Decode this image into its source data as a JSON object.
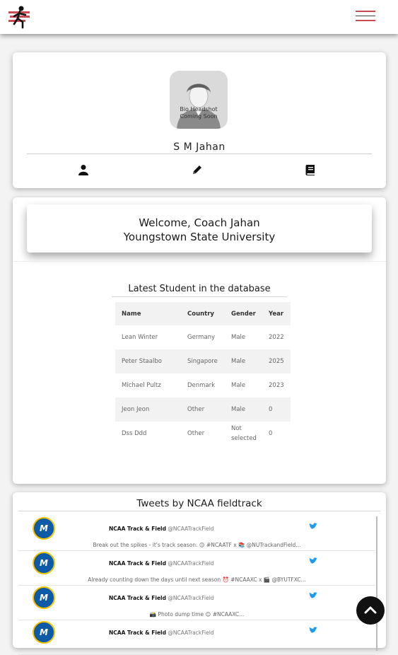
{
  "header": {
    "logo_icon": "runner-logo-icon",
    "menu_icon": "hamburger-menu-icon",
    "accent_color": "#c94c55"
  },
  "profile": {
    "avatar_caption_line1": "Bio Headshot",
    "avatar_caption_line2": "Coming Soon",
    "name": "S M Jahan",
    "icons": [
      "user-icon",
      "pencil-icon",
      "book-icon"
    ]
  },
  "welcome": {
    "line1": "Welcome, Coach Jahan",
    "line2": "Youngstown State University"
  },
  "students": {
    "title": "Latest Student in the database",
    "columns": [
      "Name",
      "Country",
      "Gender",
      "Year"
    ],
    "rows": [
      [
        "Lean Winter",
        "Germany",
        "Male",
        "2022"
      ],
      [
        "Peter Staalbo",
        "Singapore",
        "Male",
        "2025"
      ],
      [
        "Michael Pultz",
        "Denmark",
        "Male",
        "2023"
      ],
      [
        "Jeon Jeon",
        "Other",
        "Male",
        "0"
      ],
      [
        "Dss Ddd",
        "Other",
        "Not selected",
        "0"
      ]
    ]
  },
  "tweets": {
    "title": "Tweets by NCAA fieldtrack",
    "items": [
      {
        "name": "NCAA Track & Field",
        "handle": "@NCAATrackField",
        "text": "Break out the spikes - it's track season. 😊 #NCAATF x 📚 @NUTrackandField..."
      },
      {
        "name": "NCAA Track & Field",
        "handle": "@NCAATrackField",
        "text": "Already counting down the days until next season ⏰ #NCAAXC x 🎬 @BYUTFXC..."
      },
      {
        "name": "NCAA Track & Field",
        "handle": "@NCAATrackField",
        "text": "📸 Photo dump time 😊 #NCAAXC..."
      },
      {
        "name": "NCAA Track & Field",
        "handle": "@NCAATrackField",
        "text": ""
      }
    ]
  },
  "scroll_top_icon": "chevron-up-icon"
}
